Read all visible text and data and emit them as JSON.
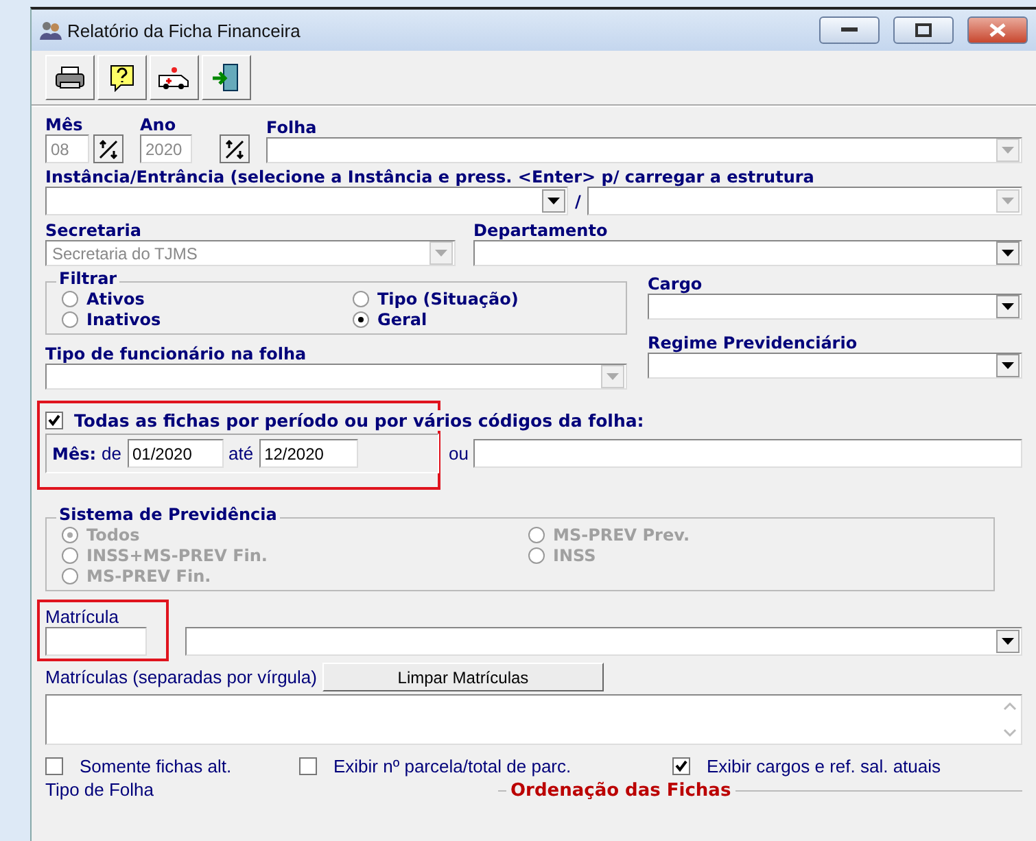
{
  "window": {
    "title": "Relatório da Ficha Financeira"
  },
  "mes": {
    "label": "Mês",
    "value": "08",
    "disabled": true
  },
  "ano": {
    "label": "Ano",
    "value": "2020",
    "disabled": true
  },
  "folha": {
    "label": "Folha",
    "disabled": true
  },
  "instancia": {
    "label": "Instância/Entrância (selecione a Instância e press. <Enter> p/ carregar a estrutura",
    "separator": "/",
    "first_disabled": false,
    "second_disabled": true
  },
  "secretaria": {
    "label": "Secretaria",
    "value": "Secretaria do TJMS",
    "disabled": true
  },
  "departamento": {
    "label": "Departamento",
    "disabled": false
  },
  "filtrar": {
    "legend": "Filtrar",
    "options": [
      {
        "label": "Ativos",
        "selected": false
      },
      {
        "label": "Tipo (Situação)",
        "selected": false
      },
      {
        "label": "Inativos",
        "selected": false
      },
      {
        "label": "Geral",
        "selected": true
      }
    ]
  },
  "cargo": {
    "label": "Cargo",
    "disabled": false
  },
  "tipo_funcionario": {
    "label": "Tipo de funcionário na folha",
    "disabled": true
  },
  "regime": {
    "label": "Regime Previdenciário",
    "disabled": false
  },
  "periodo": {
    "label": "Todas as fichas por período ou por vários códigos da folha:",
    "checked": true,
    "mes_label": "Mês:",
    "de_label": "de",
    "de": "01/2020",
    "ate_label": "até",
    "ate": "12/2020",
    "ou_label": "ou"
  },
  "previdencia": {
    "legend": "Sistema de Previdência",
    "disabled": true,
    "options": [
      {
        "label": "Todos",
        "selected": true
      },
      {
        "label": "MS-PREV Prev.",
        "selected": false
      },
      {
        "label": "INSS+MS-PREV Fin.",
        "selected": false
      },
      {
        "label": "INSS",
        "selected": false
      },
      {
        "label": "MS-PREV Fin.",
        "selected": false
      }
    ]
  },
  "matricula": {
    "label": "Matrícula"
  },
  "matriculas": {
    "label": "Matrículas (separadas por vírgula)",
    "button": "Limpar Matrículas"
  },
  "checkboxes": [
    {
      "label": "Somente fichas alt.",
      "checked": false
    },
    {
      "label": "Exibir nº parcela/total de parc.",
      "checked": false
    },
    {
      "label": "Exibir cargos e ref. sal. atuais",
      "checked": true
    }
  ],
  "tipo_folha": {
    "label": "Tipo de Folha"
  },
  "ordenacao": {
    "legend": "Ordenação das Fichas"
  }
}
